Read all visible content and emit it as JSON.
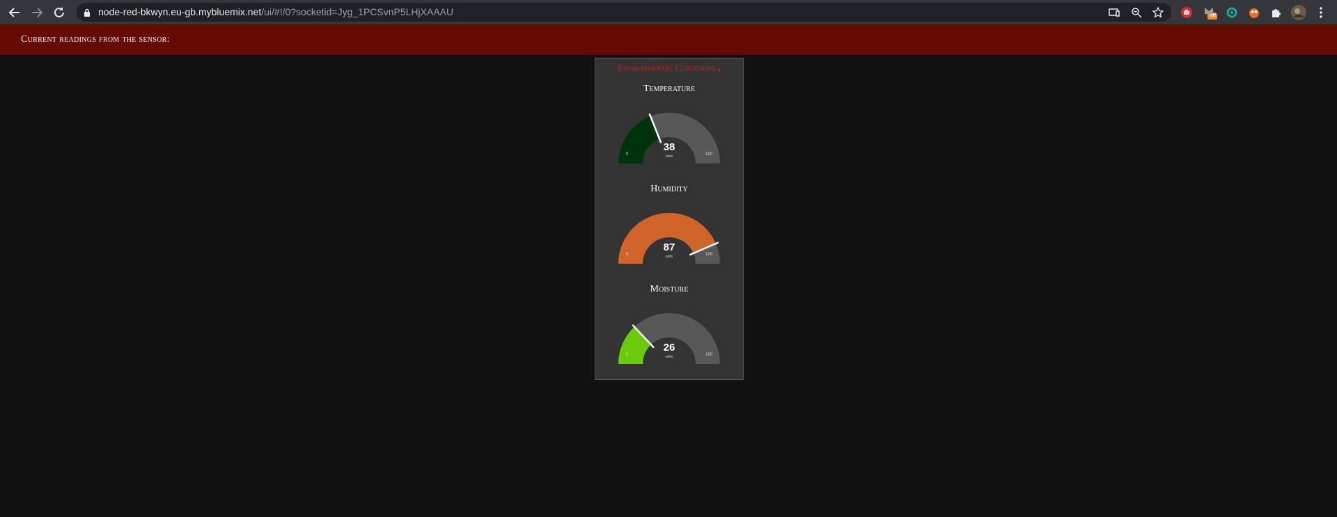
{
  "browser": {
    "url_host": "node-red-bkwyn.eu-gb.mybluemix.net",
    "url_path": "/ui/#!/0?socketid=Jyg_1PCSvnP5LHjXAAAU",
    "extension_badge": "off"
  },
  "header": {
    "title": "Current readings from the sensor:"
  },
  "group": {
    "title": "Environmental Conditions",
    "collapse_glyph": "▴",
    "gauges": [
      {
        "label": "Temperature",
        "value": 38,
        "units": "units",
        "min": "0",
        "max": "100",
        "color": "#00330a",
        "track_color": "#585858"
      },
      {
        "label": "Humidity",
        "value": 87,
        "units": "units",
        "min": "0",
        "max": "100",
        "color": "#d1642a",
        "track_color": "#585858"
      },
      {
        "label": "Moisture",
        "value": 26,
        "units": "units",
        "min": "0",
        "max": "100",
        "color": "#6acb0c",
        "track_color": "#585858"
      }
    ]
  },
  "colors": {
    "header_bg": "#650b03",
    "page_bg": "#111111",
    "group_bg": "#333333",
    "group_title": "#c0231a"
  }
}
